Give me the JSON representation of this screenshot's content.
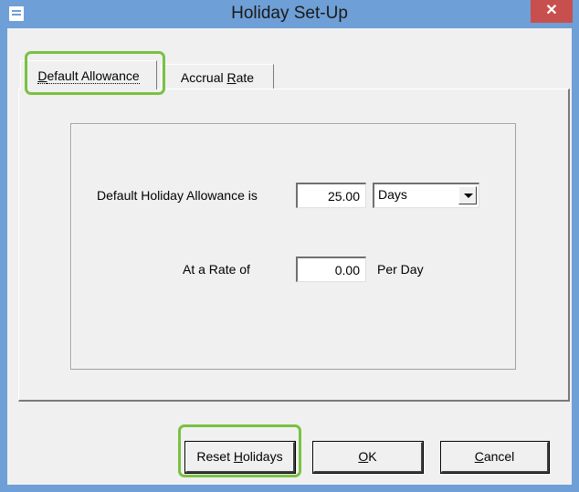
{
  "window": {
    "title": "Holiday Set-Up",
    "close_glyph": "✕",
    "accent": "#6e9fd6",
    "close_color": "#c7504f",
    "highlight_color": "#7ac142"
  },
  "tabs": [
    {
      "label_pre": "",
      "label_u": "D",
      "label_post": "efault Allowance",
      "active": true
    },
    {
      "label_pre": "Accrual ",
      "label_u": "R",
      "label_post": "ate",
      "active": false
    }
  ],
  "form": {
    "allowance_label": "Default Holiday Allowance is",
    "allowance_value": "25.00",
    "unit_selected": "Days",
    "rate_label": "At a Rate of",
    "rate_value": "0.00",
    "rate_suffix": "Per Day"
  },
  "buttons": {
    "reset_pre": "Reset ",
    "reset_u": "H",
    "reset_post": "olidays",
    "ok_u": "O",
    "ok_post": "K",
    "cancel_u": "C",
    "cancel_post": "ancel"
  }
}
